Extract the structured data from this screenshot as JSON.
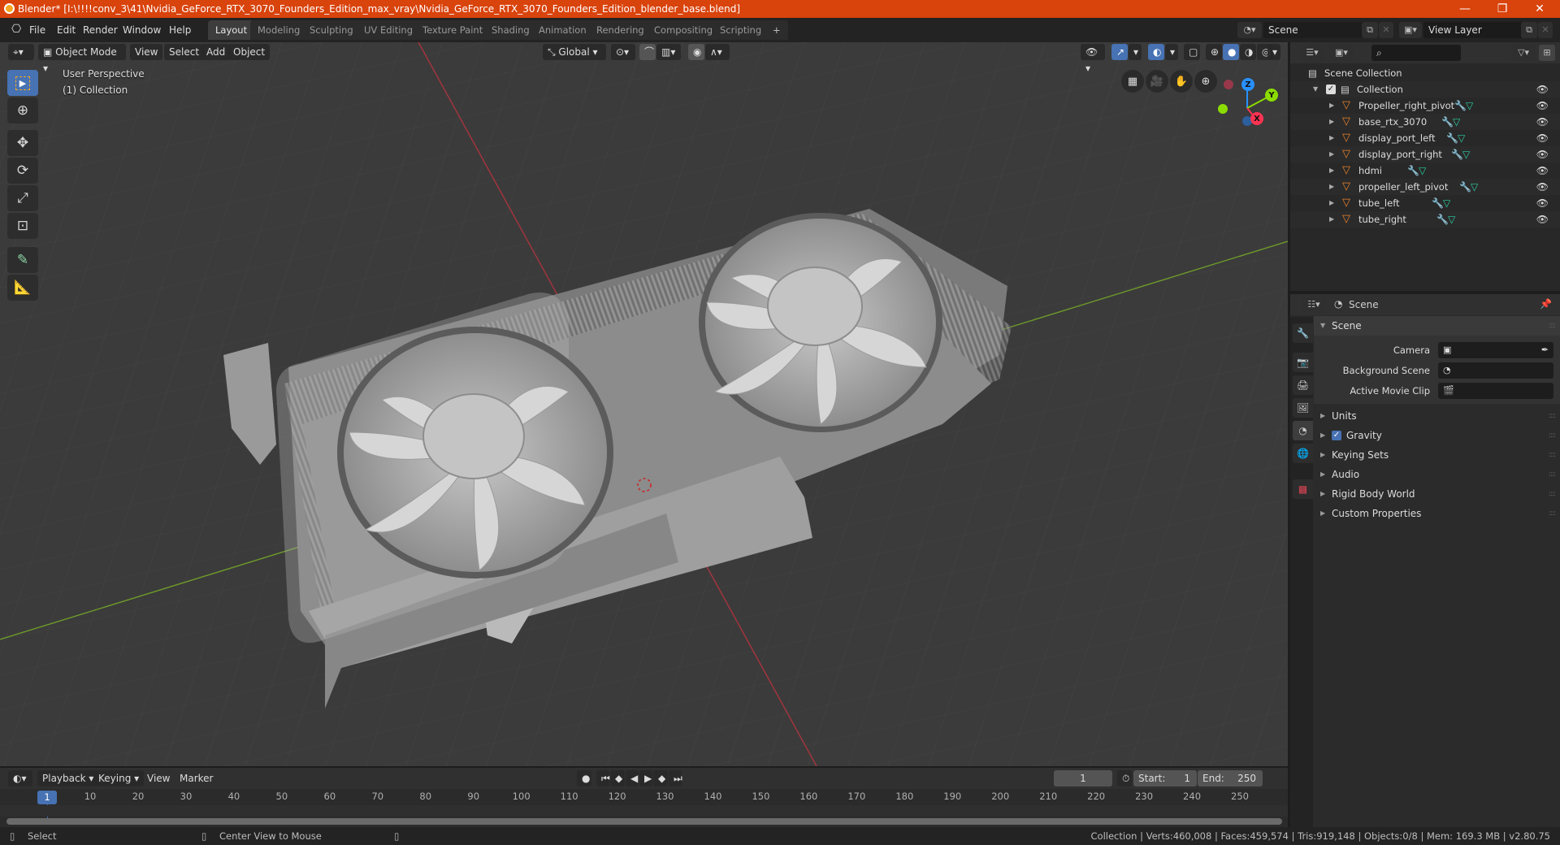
{
  "titlebar": {
    "title": "Blender* [I:\\!!!!conv_3\\41\\Nvidia_GeForce_RTX_3070_Founders_Edition_max_vray\\Nvidia_GeForce_RTX_3070_Founders_Edition_blender_base.blend]",
    "minimize": "—",
    "maximize": "❐",
    "close": "✕"
  },
  "menu": [
    "File",
    "Edit",
    "Render",
    "Window",
    "Help"
  ],
  "workspaces": [
    "Layout",
    "Modeling",
    "Sculpting",
    "UV Editing",
    "Texture Paint",
    "Shading",
    "Animation",
    "Rendering",
    "Compositing",
    "Scripting"
  ],
  "active_workspace": "Layout",
  "add_workspace": "+",
  "scene_selector": {
    "value": "Scene"
  },
  "view_layer_selector": {
    "value": "View Layer"
  },
  "viewport": {
    "mode": "Object Mode",
    "menus": [
      "View",
      "Select",
      "Add",
      "Object"
    ],
    "orientation": "Global",
    "perspective_label": "User Perspective",
    "collection_label": "(1) Collection",
    "gizmo_axes": {
      "x": "X",
      "y": "Y",
      "z": "Z"
    },
    "axis_colors": {
      "x": "#ff3352",
      "y": "#8bdc00",
      "z": "#2890ff"
    },
    "tools": [
      "select-box",
      "cursor",
      "move",
      "rotate",
      "scale",
      "transform",
      "annotate",
      "measure"
    ]
  },
  "outliner": {
    "search_placeholder": "",
    "scene_collection": "Scene Collection",
    "collection": "Collection",
    "objects": [
      "Propeller_right_pivot",
      "base_rtx_3070",
      "display_port_left",
      "display_port_right",
      "hdmi",
      "propeller_left_pivot",
      "tube_left",
      "tube_right"
    ]
  },
  "properties": {
    "context": "Scene",
    "panel_title": "Scene",
    "fields": [
      {
        "label": "Camera",
        "value": ""
      },
      {
        "label": "Background Scene",
        "value": ""
      },
      {
        "label": "Active Movie Clip",
        "value": ""
      }
    ],
    "sections": [
      "Units",
      "Gravity",
      "Keying Sets",
      "Audio",
      "Rigid Body World",
      "Custom Properties"
    ],
    "gravity_checked": true
  },
  "timeline": {
    "menus": [
      "Playback",
      "Keying",
      "View",
      "Marker"
    ],
    "current_frame": "1",
    "start_label": "Start:",
    "start": "1",
    "end_label": "End:",
    "end": "250",
    "ticks": [
      "10",
      "20",
      "30",
      "40",
      "50",
      "60",
      "70",
      "80",
      "90",
      "100",
      "110",
      "120",
      "130",
      "140",
      "150",
      "160",
      "170",
      "180",
      "190",
      "200",
      "210",
      "220",
      "230",
      "240",
      "250"
    ],
    "playhead": "1"
  },
  "statusbar": {
    "left_action": "Select",
    "middle_action": "Center View to Mouse",
    "stats": "Collection | Verts:460,008 | Faces:459,574 | Tris:919,148 | Objects:0/8 | Mem: 169.3 MB | v2.80.75"
  }
}
